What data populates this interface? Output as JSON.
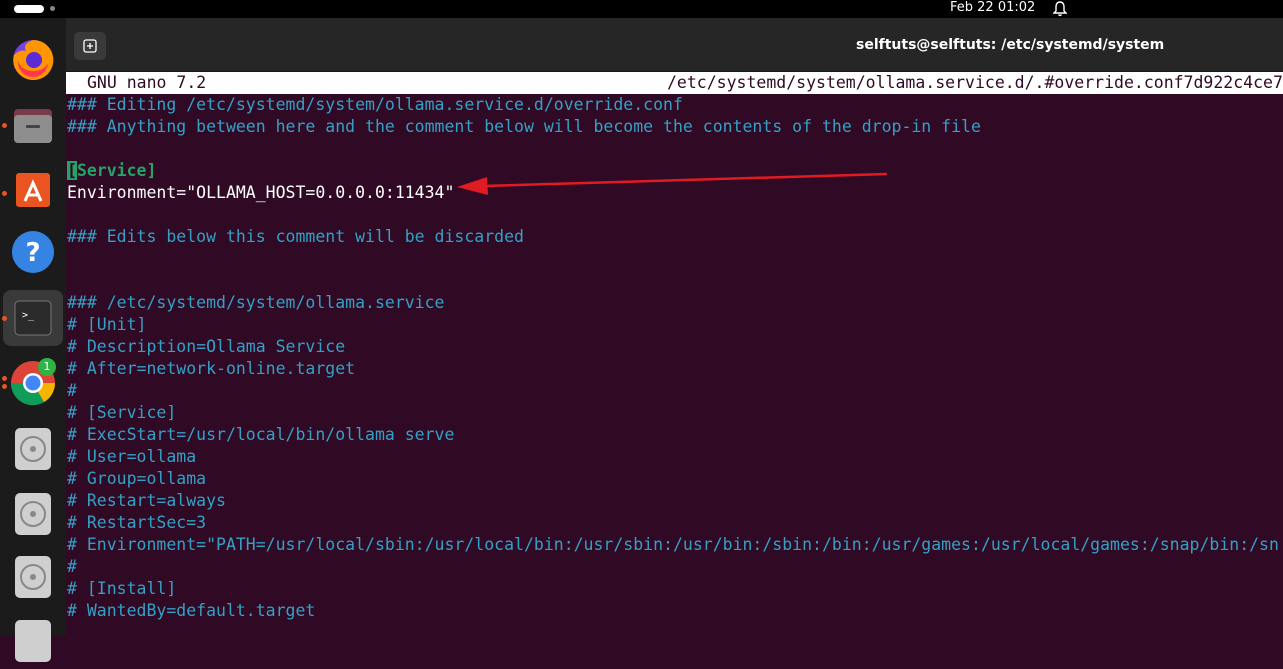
{
  "topbar": {
    "clock": "Feb 22  01:02",
    "icons": [
      "activities-indicator",
      "bell-icon"
    ]
  },
  "dock": {
    "items": [
      {
        "name": "firefox",
        "running": true
      },
      {
        "name": "files",
        "running": true
      },
      {
        "name": "app-center",
        "running": true
      },
      {
        "name": "help",
        "running": false
      },
      {
        "name": "terminal",
        "running": true,
        "active": true
      },
      {
        "name": "chrome",
        "running": true,
        "badge": "1"
      },
      {
        "name": "disc",
        "running": false
      },
      {
        "name": "disc",
        "running": false
      },
      {
        "name": "disc",
        "running": false
      },
      {
        "name": "disc",
        "running": false
      }
    ]
  },
  "window": {
    "title": "selftuts@selftuts: /etc/systemd/system",
    "new_tab_icon": "new-tab-icon"
  },
  "nano": {
    "version": "GNU nano 7.2",
    "filename": "/etc/systemd/system/ollama.service.d/.#override.conf7d922c4ce7"
  },
  "editor": {
    "lines": [
      {
        "text": "### Editing /etc/systemd/system/ollama.service.d/override.conf",
        "style": "comment"
      },
      {
        "text": "### Anything between here and the comment below will become the contents of the drop-in file",
        "style": "comment"
      },
      {
        "text": "",
        "style": "plain"
      },
      {
        "text": "[Service]",
        "style": "section"
      },
      {
        "text": "Environment=\"OLLAMA_HOST=0.0.0.0:11434\"",
        "style": "plain"
      },
      {
        "text": "",
        "style": "plain"
      },
      {
        "text": "### Edits below this comment will be discarded",
        "style": "comment"
      },
      {
        "text": "",
        "style": "plain"
      },
      {
        "text": "",
        "style": "plain"
      },
      {
        "text": "### /etc/systemd/system/ollama.service",
        "style": "comment"
      },
      {
        "text": "# [Unit]",
        "style": "comment"
      },
      {
        "text": "# Description=Ollama Service",
        "style": "comment"
      },
      {
        "text": "# After=network-online.target",
        "style": "comment"
      },
      {
        "text": "#",
        "style": "comment"
      },
      {
        "text": "# [Service]",
        "style": "comment"
      },
      {
        "text": "# ExecStart=/usr/local/bin/ollama serve",
        "style": "comment"
      },
      {
        "text": "# User=ollama",
        "style": "comment"
      },
      {
        "text": "# Group=ollama",
        "style": "comment"
      },
      {
        "text": "# Restart=always",
        "style": "comment"
      },
      {
        "text": "# RestartSec=3",
        "style": "comment"
      },
      {
        "text": "# Environment=\"PATH=/usr/local/sbin:/usr/local/bin:/usr/sbin:/usr/bin:/sbin:/bin:/usr/games:/usr/local/games:/snap/bin:/sn",
        "style": "comment"
      },
      {
        "text": "#",
        "style": "comment"
      },
      {
        "text": "# [Install]",
        "style": "comment"
      },
      {
        "text": "# WantedBy=default.target",
        "style": "comment"
      }
    ]
  },
  "colors": {
    "terminal_bg": "#300a24",
    "comment": "#34a0c6",
    "section": "#26a269",
    "annotation_arrow": "#e01b24"
  }
}
